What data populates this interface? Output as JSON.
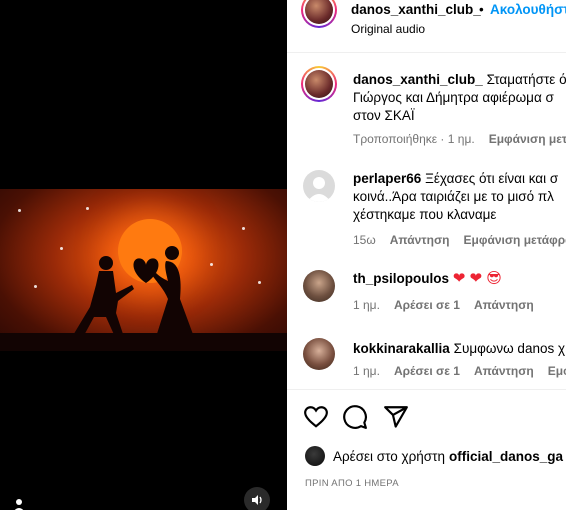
{
  "post": {
    "username": "danos_xanthi_club_",
    "separator": "•",
    "follow_label": "Ακολουθήστε",
    "audio": "Original audio"
  },
  "caption": {
    "username": "danos_xanthi_club_",
    "line1": "Σταματήστε ό",
    "line2": "Γιώργος και Δήμητρα αφιέρωμα σ",
    "line3": "στον ΣΚΑΪ",
    "edited": "Τροποποιήθηκε · 1 ημ.",
    "see_translation": "Εμφάνιση μετά"
  },
  "comments": [
    {
      "username": "perlaper66",
      "line1": "Ξέχασες ότι είναι και σ",
      "line2": "κοινά..Άρα ταιριάζει με το μισό πλ",
      "line3": "χέστηκαμε που κλαναμε",
      "time": "15ω",
      "reply": "Απάντηση",
      "see_translation": "Εμφάνιση μετάφρασ"
    },
    {
      "username": "th_psilopoulos",
      "emoji": "❤ ❤ 😎",
      "time": "1 ημ.",
      "likes": "Αρέσει σε 1",
      "reply": "Απάντηση"
    },
    {
      "username": "kokkinarakallia",
      "text": "Συμφωνω danos χ",
      "time": "1 ημ.",
      "likes": "Αρέσει σε 1",
      "reply": "Απάντηση",
      "see_translation": "Εμφάν"
    }
  ],
  "liked_by": {
    "prefix": "Αρέσει στο χρήστη",
    "username": "official_danos_ga"
  },
  "date": "ΠΡΙΝ ΑΠΟ 1 ΗΜΕΡΑ",
  "icons": [
    "heart-icon",
    "comment-icon",
    "share-icon",
    "speaker-icon",
    "user-tag-icon"
  ]
}
